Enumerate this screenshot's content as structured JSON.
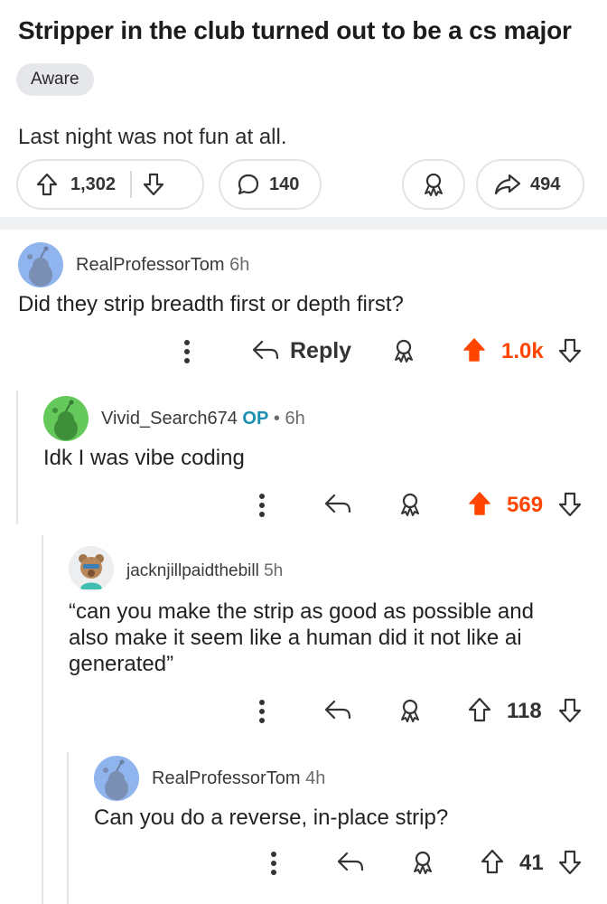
{
  "post": {
    "title": "Stripper in the club turned out to be a cs major",
    "flair": "Aware",
    "body": "Last night was not fun at all.",
    "upvotes": "1,302",
    "comments": "140",
    "shares": "494"
  },
  "comments": [
    {
      "username": "RealProfessorTom",
      "time": "6h",
      "text": "Did they strip breadth first or depth first?",
      "reply_label": "Reply",
      "score": "1.0k"
    },
    {
      "username": "Vivid_Search674",
      "op": "OP",
      "separator": "•",
      "time": "6h",
      "text": "Idk I was vibe coding",
      "score": "569"
    },
    {
      "username": "jacknjillpaidthebill",
      "time": "5h",
      "text_lines": [
        "“can you make the strip as good as possible and",
        "also make it seem like a human did it not like ai",
        "generated”"
      ],
      "score": "118"
    },
    {
      "username": "RealProfessorTom",
      "time": "4h",
      "text": "Can you do a reverse, in-place strip?",
      "score": "41"
    }
  ],
  "colors": {
    "upvote_active": "#ff4500",
    "op_badge": "#1a8fb0",
    "avatar_blue": "#8fb4ee",
    "avatar_green": "#64c85a"
  }
}
